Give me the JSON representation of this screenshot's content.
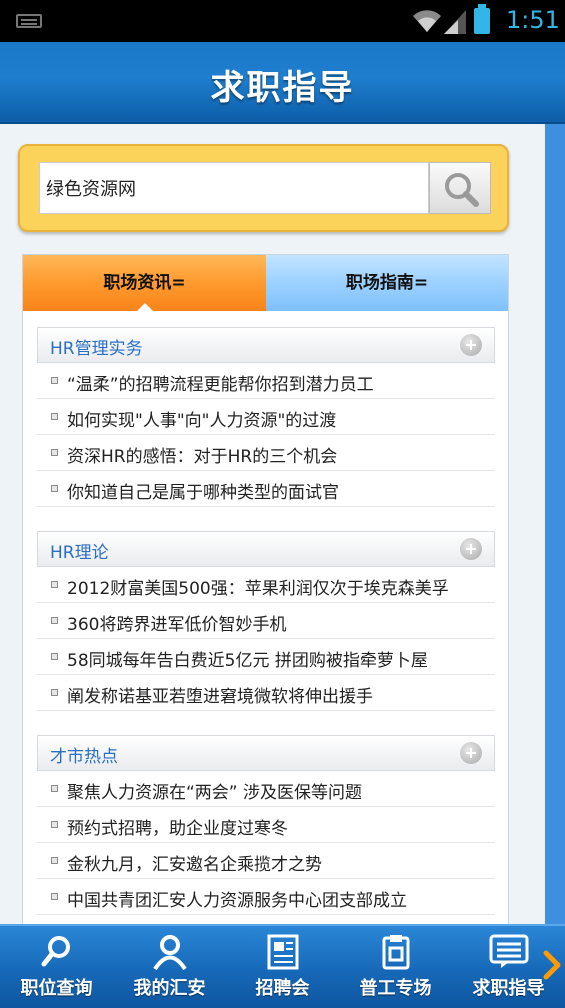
{
  "status_bar": {
    "time": "1:51"
  },
  "header": {
    "title": "求职指导"
  },
  "search": {
    "value": "绿色资源网"
  },
  "tabs": [
    {
      "label": "职场资讯=",
      "active": true
    },
    {
      "label": "职场指南=",
      "active": false
    }
  ],
  "sections": [
    {
      "title": "HR管理实务",
      "items": [
        "“温柔”的招聘流程更能帮你招到潜力员工",
        "如何实现\"人事\"向\"人力资源\"的过渡",
        "资深HR的感悟：对于HR的三个机会",
        "你知道自己是属于哪种类型的面试官"
      ]
    },
    {
      "title": "HR理论",
      "items": [
        "2012财富美国500强：苹果利润仅次于埃克森美孚",
        "360将跨界进军低价智妙手机",
        "58同城每年告白费近5亿元 拼团购被指牵萝卜屋",
        "阐发称诺基亚若堕进窘境微软将伸出援手"
      ]
    },
    {
      "title": "才市热点",
      "items": [
        "聚焦人力资源在“两会” 涉及医保等问题",
        "预约式招聘，助企业度过寒冬",
        "金秋九月，汇安邀名企乘揽才之势",
        "中国共青团汇安人力资源服务中心团支部成立"
      ]
    }
  ],
  "bottom_nav": [
    {
      "label": "职位查询",
      "icon": "search-icon"
    },
    {
      "label": "我的汇安",
      "icon": "user-icon"
    },
    {
      "label": "招聘会",
      "icon": "newspaper-icon"
    },
    {
      "label": "普工专场",
      "icon": "document-icon"
    },
    {
      "label": "求职指导",
      "icon": "message-icon"
    }
  ],
  "colors": {
    "accent_blue": "#1f7ece",
    "tab_active": "#ff9a2e",
    "tab_inactive": "#9cd1ff",
    "search_frame": "#fbd35b",
    "section_title": "#2a6fc4"
  }
}
